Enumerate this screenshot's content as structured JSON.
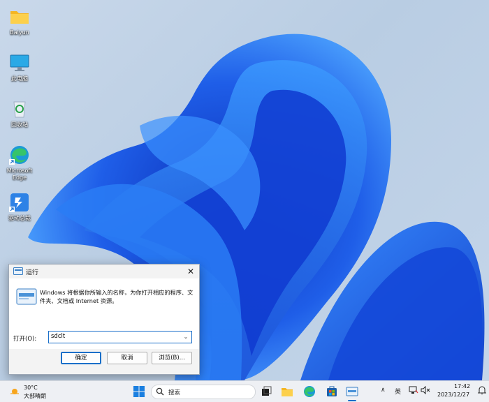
{
  "desktop": {
    "icons": [
      {
        "label": "Baiyun"
      },
      {
        "label": "此电脑"
      },
      {
        "label": "回收站"
      },
      {
        "label": "Microsoft Edge"
      },
      {
        "label": "驱动总裁"
      }
    ]
  },
  "run_dialog": {
    "title": "运行",
    "close": "✕",
    "description": "Windows 将根据你所输入的名称，为你打开相应的程序、文件夹、文档或 Internet 资源。",
    "open_label": "打开(O):",
    "input_value": "sdclt",
    "dropdown_glyph": "⌄",
    "ok_label": "确定",
    "cancel_label": "取消",
    "browse_label": "浏览(B)..."
  },
  "taskbar": {
    "weather_temp": "30°C",
    "weather_desc": "大部晴朗",
    "search_placeholder": "搜索",
    "tray_chevron": "∧",
    "ime": "英",
    "clock_time": "17:42",
    "clock_date": "2023/12/27"
  },
  "colors": {
    "accent": "#1a6fc9",
    "taskbar_bg": "#eef0f4",
    "wallpaper_bg": "#c2d4e8",
    "bloom_blue": "#1f5ee8"
  }
}
